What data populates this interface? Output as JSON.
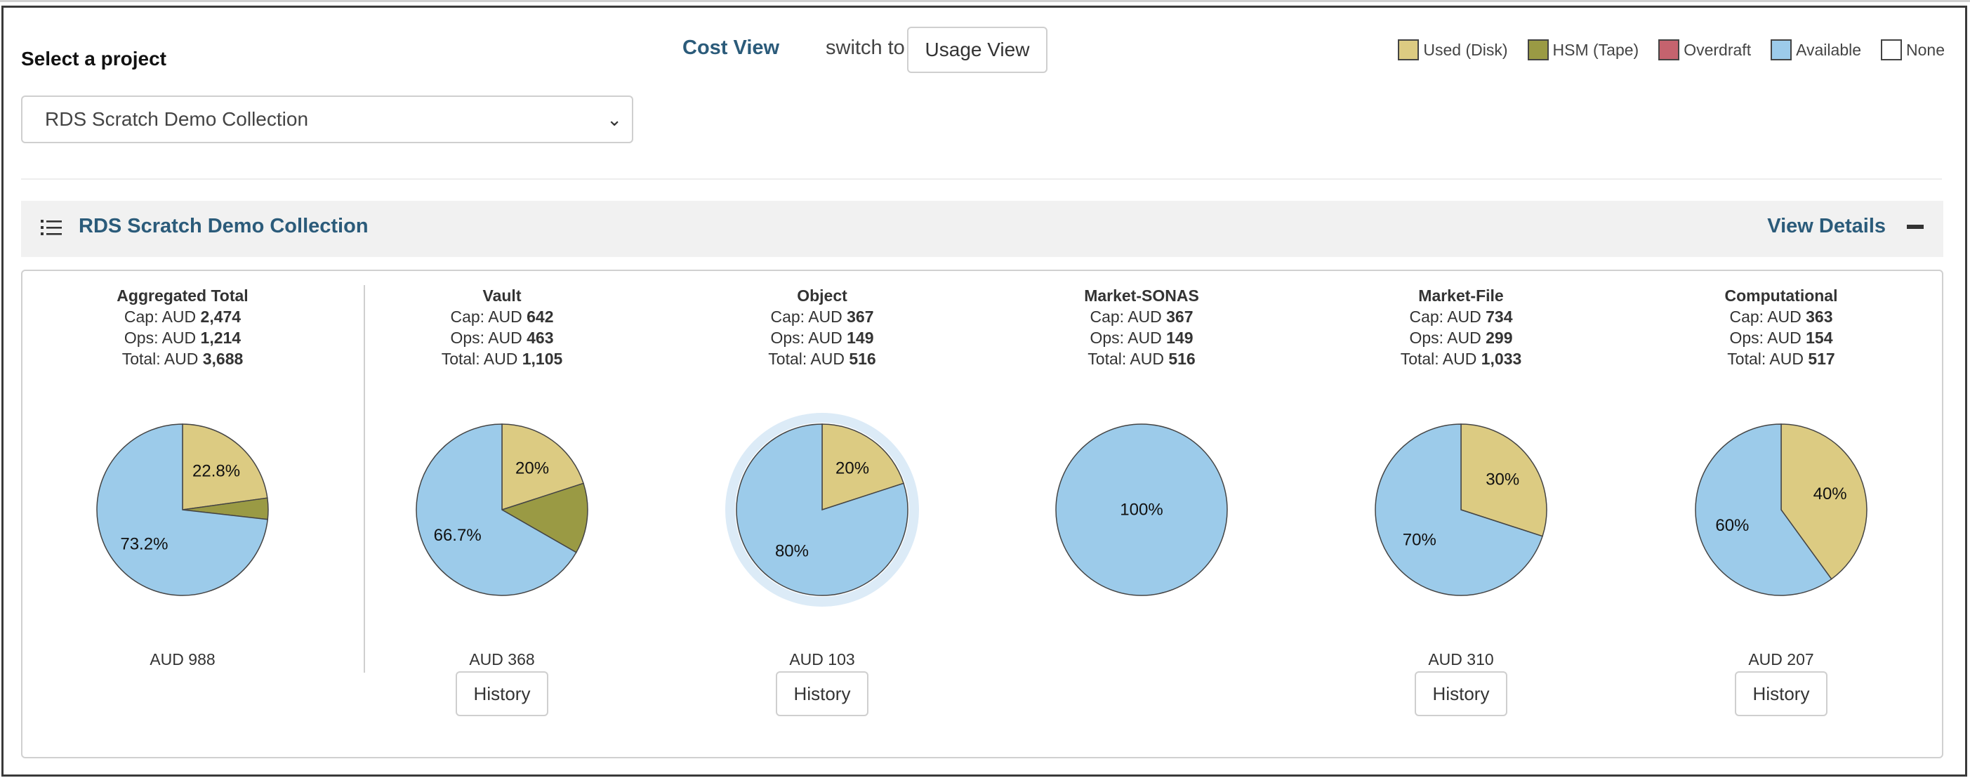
{
  "header": {
    "select_label": "Select a project",
    "selected_project": "RDS Scratch Demo Collection",
    "cost_view_label": "Cost View",
    "switch_to_label": "switch to",
    "usage_view_button": "Usage View"
  },
  "legend": [
    {
      "label": "Used (Disk)",
      "color": "#dccb82"
    },
    {
      "label": "HSM (Tape)",
      "color": "#9a9a44"
    },
    {
      "label": "Overdraft",
      "color": "#c5636e"
    },
    {
      "label": "Available",
      "color": "#9ccbea"
    },
    {
      "label": "None",
      "color": "#ffffff"
    }
  ],
  "panel": {
    "title": "RDS Scratch Demo Collection",
    "view_details": "View Details"
  },
  "cards": [
    {
      "name": "Aggregated Total",
      "cap_prefix": "Cap: AUD ",
      "cap": "2,474",
      "ops_prefix": "Ops: AUD ",
      "ops": "1,214",
      "total_prefix": "Total: AUD ",
      "total": "3,688",
      "available": "AUD 988",
      "history": ""
    },
    {
      "name": "Vault",
      "cap_prefix": "Cap: AUD ",
      "cap": "642",
      "ops_prefix": "Ops: AUD ",
      "ops": "463",
      "total_prefix": "Total: AUD ",
      "total": "1,105",
      "available": "AUD 368",
      "history": "History"
    },
    {
      "name": "Object",
      "cap_prefix": "Cap: AUD ",
      "cap": "367",
      "ops_prefix": "Ops: AUD ",
      "ops": "149",
      "total_prefix": "Total: AUD ",
      "total": "516",
      "available": "AUD 103",
      "history": "History"
    },
    {
      "name": "Market-SONAS",
      "cap_prefix": "Cap: AUD ",
      "cap": "367",
      "ops_prefix": "Ops: AUD ",
      "ops": "149",
      "total_prefix": "Total: AUD ",
      "total": "516",
      "available": "",
      "history": ""
    },
    {
      "name": "Market-File",
      "cap_prefix": "Cap: AUD ",
      "cap": "734",
      "ops_prefix": "Ops: AUD ",
      "ops": "299",
      "total_prefix": "Total: AUD ",
      "total": "1,033",
      "available": "AUD 310",
      "history": "History"
    },
    {
      "name": "Computational",
      "cap_prefix": "Cap: AUD ",
      "cap": "363",
      "ops_prefix": "Ops: AUD ",
      "ops": "154",
      "total_prefix": "Total: AUD ",
      "total": "517",
      "available": "AUD 207",
      "history": "History"
    }
  ],
  "chart_data": [
    {
      "type": "pie",
      "title": "Aggregated Total",
      "slices": [
        {
          "name": "Used (Disk)",
          "value": 22.8,
          "label": "22.8%",
          "color": "#dccb82"
        },
        {
          "name": "HSM (Tape)",
          "value": 4.0,
          "label": "",
          "color": "#9a9a44"
        },
        {
          "name": "Available",
          "value": 73.2,
          "label": "73.2%",
          "color": "#9ccbea"
        }
      ]
    },
    {
      "type": "pie",
      "title": "Vault",
      "slices": [
        {
          "name": "Used (Disk)",
          "value": 20,
          "label": "20%",
          "color": "#dccb82"
        },
        {
          "name": "HSM (Tape)",
          "value": 13.3,
          "label": "",
          "color": "#9a9a44"
        },
        {
          "name": "Available",
          "value": 66.7,
          "label": "66.7%",
          "color": "#9ccbea"
        }
      ]
    },
    {
      "type": "pie",
      "title": "Object",
      "highlight_ring": true,
      "slices": [
        {
          "name": "Used (Disk)",
          "value": 20,
          "label": "20%",
          "color": "#dccb82"
        },
        {
          "name": "Available",
          "value": 80,
          "label": "80%",
          "color": "#9ccbea"
        }
      ]
    },
    {
      "type": "pie",
      "title": "Market-SONAS",
      "slices": [
        {
          "name": "Available",
          "value": 100,
          "label": "100%",
          "color": "#9ccbea"
        }
      ]
    },
    {
      "type": "pie",
      "title": "Market-File",
      "slices": [
        {
          "name": "Used (Disk)",
          "value": 30,
          "label": "30%",
          "color": "#dccb82"
        },
        {
          "name": "Available",
          "value": 70,
          "label": "70%",
          "color": "#9ccbea"
        }
      ]
    },
    {
      "type": "pie",
      "title": "Computational",
      "slices": [
        {
          "name": "Used (Disk)",
          "value": 40,
          "label": "40%",
          "color": "#dccb82"
        },
        {
          "name": "Available",
          "value": 60,
          "label": "60%",
          "color": "#9ccbea"
        }
      ]
    }
  ]
}
